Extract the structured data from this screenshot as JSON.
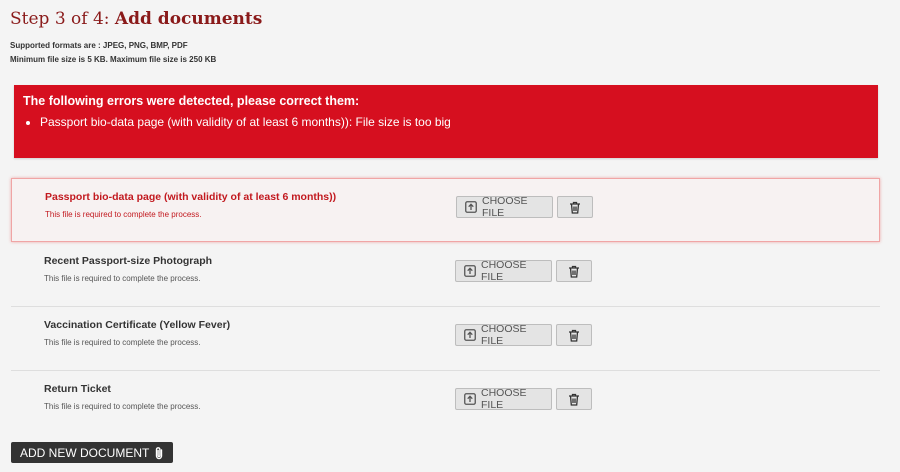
{
  "header": {
    "step_prefix": "Step 3 of 4: ",
    "step_title": "Add documents",
    "formats_line": "Supported formats are : JPEG, PNG, BMP, PDF",
    "size_line": "Minimum file size is 5 KB. Maximum file size is 250 KB"
  },
  "errors": {
    "heading": "The following errors were detected, please correct them:",
    "items": [
      "Passport bio-data page (with validity of at least 6 months)): File size is too big"
    ]
  },
  "documents": [
    {
      "name": "Passport bio-data page (with validity of at least 6 months))",
      "note": "This file is required to complete the process.",
      "state": "error"
    },
    {
      "name": "Recent Passport-size Photograph",
      "note": "This file is required to complete the process.",
      "state": "normal"
    },
    {
      "name": "Vaccination Certificate (Yellow Fever)",
      "note": "This file is required to complete the process.",
      "state": "normal"
    },
    {
      "name": "Return Ticket",
      "note": "This file is required to complete the process.",
      "state": "normal"
    }
  ],
  "buttons": {
    "choose_file": "CHOOSE FILE",
    "add_new_document": "ADD NEW DOCUMENT"
  },
  "icons": {
    "choose": "upload-icon",
    "delete": "trash-icon",
    "add": "paperclip-icon"
  },
  "colors": {
    "title": "#8a1a1a",
    "error_bg": "#d60f1f",
    "error_text": "#c2191f",
    "add_button_bg": "#333333"
  }
}
